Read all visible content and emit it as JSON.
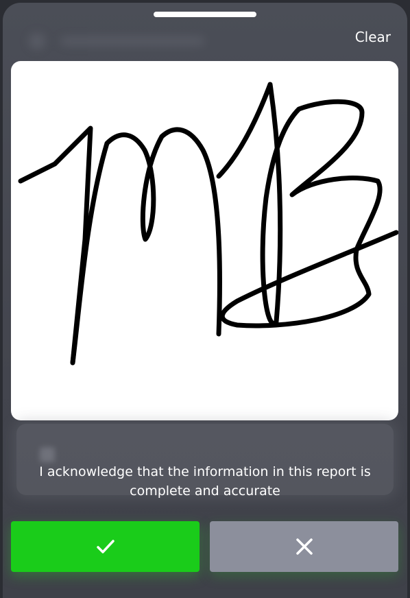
{
  "header": {
    "clear_label": "Clear"
  },
  "acknowledgement": {
    "text_line1": "I acknowledge that the information in this report is",
    "text_line2": "complete and accurate"
  },
  "actions": {
    "confirm_icon": "checkmark-icon",
    "cancel_icon": "close-icon"
  },
  "colors": {
    "confirm": "#1acc1a",
    "cancel": "#8c8f9c",
    "sheet_background": "#4b4e57",
    "signature_ink": "#000000"
  }
}
